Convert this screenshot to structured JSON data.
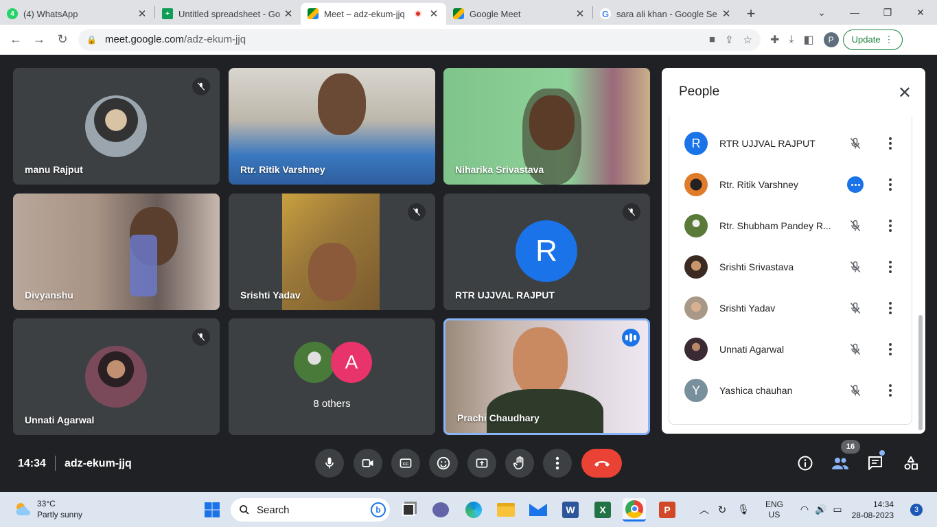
{
  "browser": {
    "tabs": [
      {
        "title": "(4) WhatsApp",
        "icon": "whatsapp-icon"
      },
      {
        "title": "Untitled spreadsheet - Go",
        "icon": "sheets-icon"
      },
      {
        "title": "Meet – adz-ekum-jjq",
        "icon": "meet-icon",
        "active": true
      },
      {
        "title": "Google Meet",
        "icon": "meet-icon"
      },
      {
        "title": "sara ali khan - Google Se",
        "icon": "google-icon"
      }
    ],
    "url_host": "meet.google.com",
    "url_path": "/adz-ekum-jjq",
    "profile_initial": "P",
    "update_label": "Update"
  },
  "tiles": [
    {
      "name": "manu Rajput",
      "muted": true
    },
    {
      "name": "Rtr. Ritik Varshney",
      "muted": false
    },
    {
      "name": "Niharika Srivastava",
      "muted": false
    },
    {
      "name": "Divyanshu",
      "muted": false
    },
    {
      "name": "Srishti Yadav",
      "muted": true
    },
    {
      "name": "RTR UJJVAL RAJPUT",
      "muted": true,
      "initial": "R"
    },
    {
      "name": "Unnati Agarwal",
      "muted": true
    },
    {
      "name": "8 others",
      "initial": "A"
    },
    {
      "name": "Prachi Chaudhary",
      "speaking": true
    }
  ],
  "people_panel": {
    "title": "People",
    "participants": [
      {
        "name": "RTR UJJVAL RAJPUT",
        "initial": "R",
        "status": "muted",
        "avatar_color": "#1a73e8"
      },
      {
        "name": "Rtr. Ritik Varshney",
        "status": "speaking",
        "avatar_color": "#5a3b2a"
      },
      {
        "name": "Rtr. Shubham Pandey R...",
        "status": "muted",
        "avatar_color": "#6b7a4a"
      },
      {
        "name": "Srishti Srivastava",
        "status": "muted",
        "avatar_color": "#8a6a5a"
      },
      {
        "name": "Srishti Yadav",
        "status": "muted",
        "avatar_color": "#b8a090"
      },
      {
        "name": "Unnati Agarwal",
        "status": "muted",
        "avatar_color": "#4a3a4a"
      },
      {
        "name": "Yashica chauhan",
        "initial": "Y",
        "status": "muted",
        "avatar_color": "#78909c"
      }
    ]
  },
  "meeting": {
    "time": "14:34",
    "code": "adz-ekum-jjq",
    "participant_count": "16"
  },
  "taskbar": {
    "temperature": "33°C",
    "weather": "Partly sunny",
    "search_label": "Search",
    "lang_top": "ENG",
    "lang_bottom": "US",
    "time": "14:34",
    "date": "28-08-2023",
    "notification_count": "3"
  }
}
